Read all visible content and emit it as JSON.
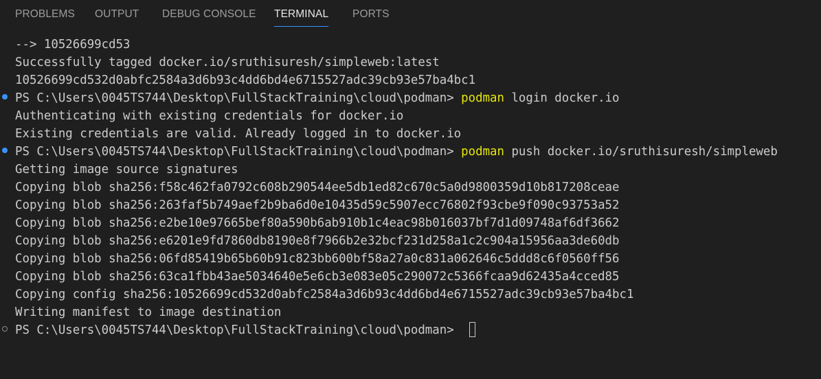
{
  "tabs": [
    {
      "label": "PROBLEMS"
    },
    {
      "label": "OUTPUT"
    },
    {
      "label": "DEBUG CONSOLE"
    },
    {
      "label": "TERMINAL"
    },
    {
      "label": "PORTS"
    }
  ],
  "active_tab": "TERMINAL",
  "colors": {
    "background": "#1f1f1f",
    "text": "#cccccc",
    "command": "#e5e510",
    "active_tab_underline": "#3794ff",
    "success_decoration": "#3794ff"
  },
  "terminal": {
    "lines": [
      {
        "text": "--> 10526699cd53"
      },
      {
        "text": "Successfully tagged docker.io/sruthisuresh/simpleweb:latest"
      },
      {
        "text": "10526699cd532d0abfc2584a3d6b93c4dd6bd4e6715527adc39cb93e57ba4bc1"
      },
      {
        "prompt": "PS C:\\Users\\0045TS744\\Desktop\\FullStackTraining\\cloud\\podman> ",
        "command": "podman",
        "args": " login docker.io"
      },
      {
        "text": "Authenticating with existing credentials for docker.io"
      },
      {
        "text": "Existing credentials are valid. Already logged in to docker.io"
      },
      {
        "prompt": "PS C:\\Users\\0045TS744\\Desktop\\FullStackTraining\\cloud\\podman> ",
        "command": "podman",
        "args": " push docker.io/sruthisuresh/simpleweb"
      },
      {
        "text": "Getting image source signatures"
      },
      {
        "text": "Copying blob sha256:f58c462fa0792c608b290544ee5db1ed82c670c5a0d9800359d10b817208ceae"
      },
      {
        "text": "Copying blob sha256:263faf5b749aef2b9ba6d0e10435d59c5907ecc76802f93cbe9f090c93753a52"
      },
      {
        "text": "Copying blob sha256:e2be10e97665bef80a590b6ab910b1c4eac98b016037bf7d1d09748af6df3662"
      },
      {
        "text": "Copying blob sha256:e6201e9fd7860db8190e8f7966b2e32bcf231d258a1c2c904a15956aa3de60db"
      },
      {
        "text": "Copying blob sha256:06fd85419b65b60b91c823bb600bf58a27a0c831a062646c5ddd8c6f0560ff56"
      },
      {
        "text": "Copying blob sha256:63ca1fbb43ae5034640e5e6cb3e083e05c290072c5366fcaa9d62435a4cced85"
      },
      {
        "text": "Copying config sha256:10526699cd532d0abfc2584a3d6b93c4dd6bd4e6715527adc39cb93e57ba4bc1"
      },
      {
        "text": "Writing manifest to image destination"
      },
      {
        "prompt": "PS C:\\Users\\0045TS744\\Desktop\\FullStackTraining\\cloud\\podman> "
      }
    ]
  }
}
